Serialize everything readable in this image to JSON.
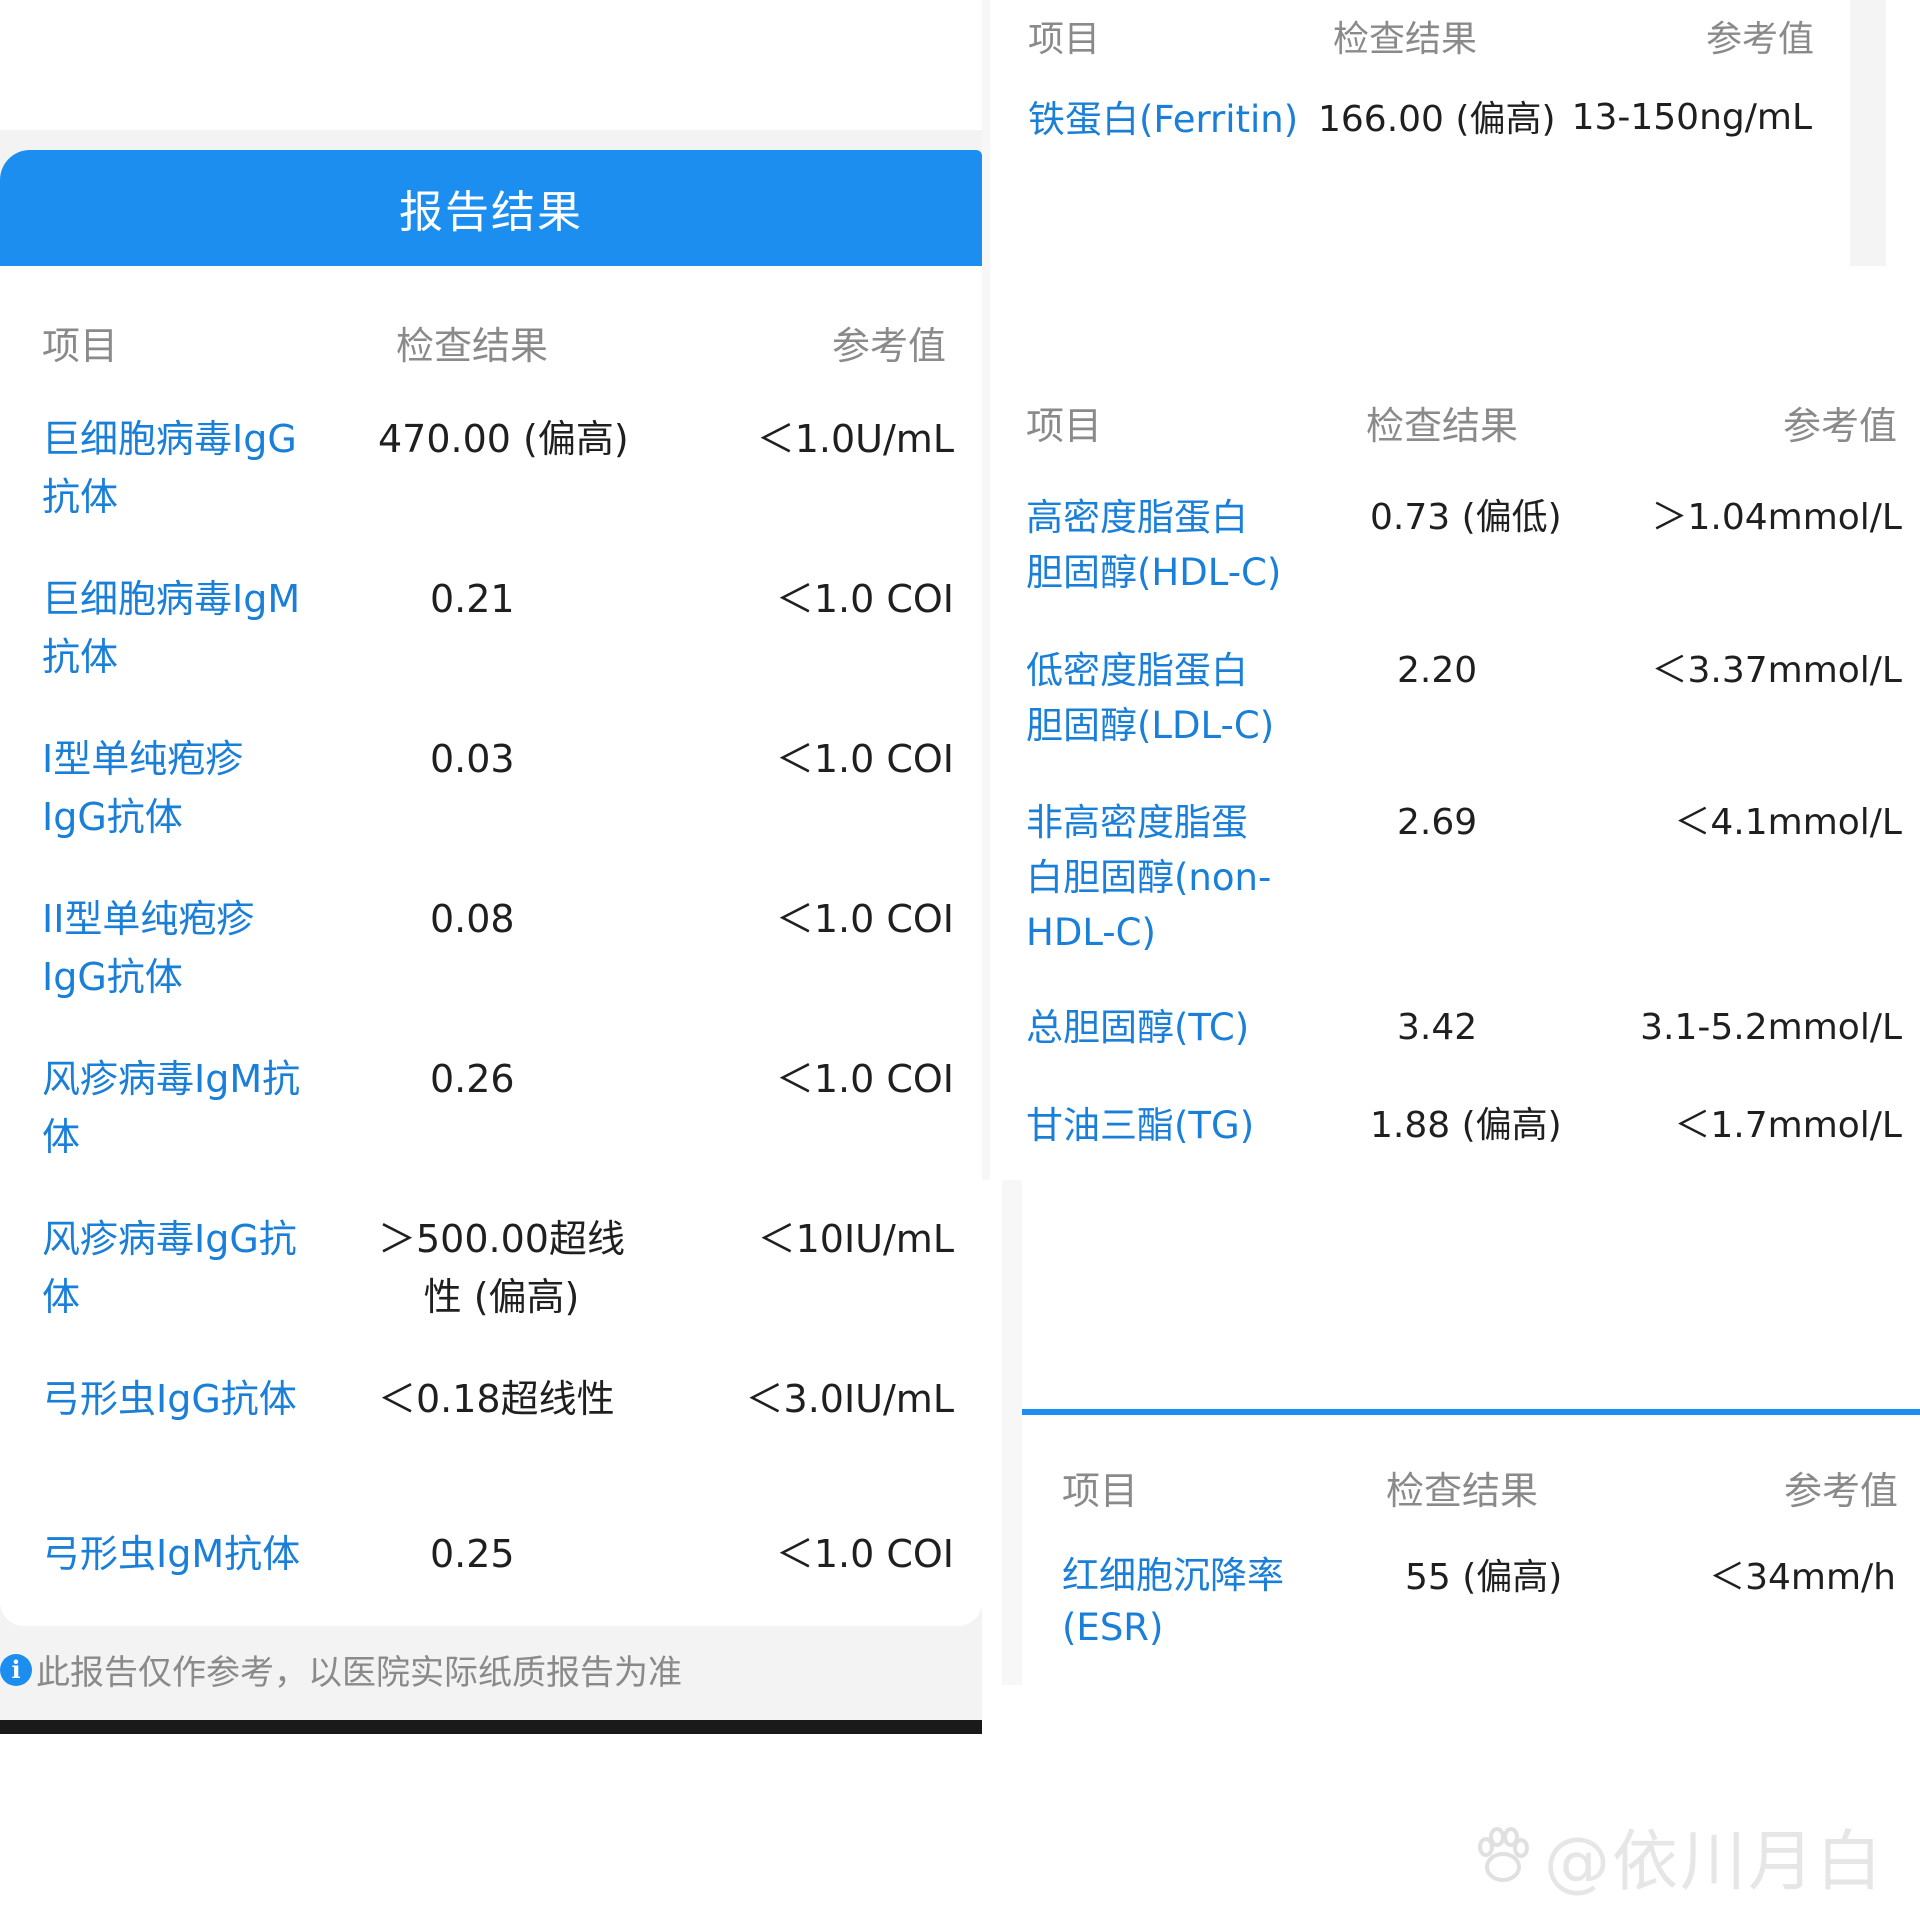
{
  "left_panel": {
    "title": "报告结果",
    "headers": {
      "item": "项目",
      "result": "检查结果",
      "ref": "参考值"
    },
    "rows": [
      {
        "item": [
          "巨细胞病毒IgG",
          "抗体"
        ],
        "result": [
          "470.00 (偏高)"
        ],
        "ref": "＜1.0U/mL"
      },
      {
        "item": [
          "巨细胞病毒IgM",
          "抗体"
        ],
        "result": [
          "0.21"
        ],
        "ref": "＜1.0 COI"
      },
      {
        "item": [
          "I型单纯疱疹",
          "IgG抗体"
        ],
        "result": [
          "0.03"
        ],
        "ref": "＜1.0 COI"
      },
      {
        "item": [
          "II型单纯疱疹",
          "IgG抗体"
        ],
        "result": [
          "0.08"
        ],
        "ref": "＜1.0 COI"
      },
      {
        "item": [
          "风疹病毒IgM抗",
          "体"
        ],
        "result": [
          "0.26"
        ],
        "ref": "＜1.0 COI"
      },
      {
        "item": [
          "风疹病毒IgG抗",
          "体"
        ],
        "result": [
          "＞500.00超线",
          "性 (偏高)"
        ],
        "ref": "＜10IU/mL"
      },
      {
        "item": [
          "弓形虫IgG抗体"
        ],
        "result": [
          "＜0.18超线性"
        ],
        "ref": "＜3.0IU/mL"
      },
      {
        "item": [
          "弓形虫IgM抗体"
        ],
        "result": [
          "0.25"
        ],
        "ref": "＜1.0 COI"
      }
    ],
    "note": "此报告仅作参考，以医院实际纸质报告为准"
  },
  "ferritin_panel": {
    "headers": {
      "item": "项目",
      "result": "检查结果",
      "ref": "参考值"
    },
    "rows": [
      {
        "item": "铁蛋白(Ferritin)",
        "result": "166.00 (偏高)",
        "ref": "13-150ng/mL"
      }
    ]
  },
  "lipid_panel": {
    "headers": {
      "item": "项目",
      "result": "检查结果",
      "ref": "参考值"
    },
    "rows": [
      {
        "item": [
          "高密度脂蛋白",
          "胆固醇(HDL-C)"
        ],
        "result": "0.73 (偏低)",
        "ref": "＞1.04mmol/L"
      },
      {
        "item": [
          "低密度脂蛋白",
          "胆固醇(LDL-C)"
        ],
        "result": "2.20",
        "ref": "＜3.37mmol/L"
      },
      {
        "item": [
          "非高密度脂蛋",
          "白胆固醇(non-",
          "HDL-C)"
        ],
        "result": "2.69",
        "ref": "＜4.1mmol/L"
      },
      {
        "item": [
          "总胆固醇(TC)"
        ],
        "result": "3.42",
        "ref": "3.1-5.2mmol/L"
      },
      {
        "item": [
          "甘油三酯(TG)"
        ],
        "result": "1.88 (偏高)",
        "ref": "＜1.7mmol/L"
      }
    ]
  },
  "esr_panel": {
    "headers": {
      "item": "项目",
      "result": "检查结果",
      "ref": "参考值"
    },
    "rows": [
      {
        "item": [
          "红细胞沉降率",
          "(ESR)"
        ],
        "result": "55 (偏高)",
        "ref": "＜34mm/h"
      }
    ]
  },
  "watermark": "@依川月白",
  "colors": {
    "accent": "#1c8ef0",
    "item_text": "#1a7fd8",
    "header_text": "#8a8a8a"
  }
}
